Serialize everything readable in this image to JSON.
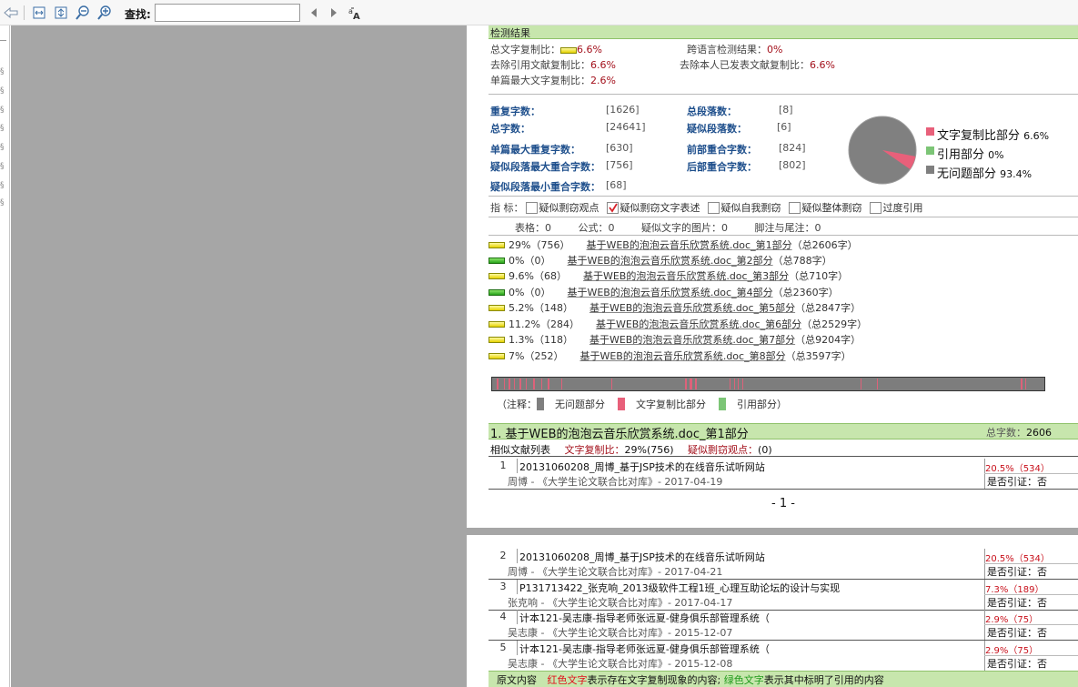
{
  "toolbar": {
    "find_label": "查找:",
    "find_value": ""
  },
  "section_header": "检测结果",
  "summary": {
    "total_copy_label": "总文字复制比：",
    "total_copy_value": "6.6%",
    "cross_lang_label": "跨语言检测结果：",
    "cross_lang_value": "0%",
    "excl_cite_label": "去除引用文献复制比：",
    "excl_cite_value": "6.6%",
    "excl_self_label": "去除本人已发表文献复制比：",
    "excl_self_value": "6.6%",
    "single_max_label": "单篇最大文字复制比：",
    "single_max_value": "2.6%"
  },
  "stats": {
    "dup_chars_label": "重复字数：",
    "dup_chars": "[1626]",
    "total_paras_label": "总段落数：",
    "total_paras": "[8]",
    "total_chars_label": "总字数：",
    "total_chars": "[24641]",
    "susp_paras_label": "疑似段落数：",
    "susp_paras": "[6]",
    "single_max_dup_label": "单篇最大重复字数：",
    "single_max_dup": "[630]",
    "front_overlap_label": "前部重合字数：",
    "front_overlap": "[824]",
    "susp_max_label": "疑似段落最大重合字数：",
    "susp_max": "[756]",
    "back_overlap_label": "后部重合字数：",
    "back_overlap": "[802]",
    "susp_min_label": "疑似段落最小重合字数：",
    "susp_min": "[68]"
  },
  "pie": {
    "legend": [
      {
        "label": "文字复制比部分",
        "value": "6.6%",
        "color": "#e8607a"
      },
      {
        "label": "引用部分",
        "value": "0%",
        "color": "#7cc576"
      },
      {
        "label": "无问题部分",
        "value": "93.4%",
        "color": "#7f7f7f"
      }
    ],
    "copy_fraction": 0.066
  },
  "indicators": {
    "label": "指  标：",
    "items": [
      {
        "label": "疑似剽窃观点",
        "checked": false
      },
      {
        "label": "疑似剽窃文字表述",
        "checked": true
      },
      {
        "label": "疑似自我剽窃",
        "checked": false
      },
      {
        "label": "疑似整体剽窃",
        "checked": false
      },
      {
        "label": "过度引用",
        "checked": false
      }
    ]
  },
  "extras": {
    "tables": "表格：0",
    "formulas": "公式：0",
    "images": "疑似文字的图片：0",
    "footnotes": "脚注与尾注：0"
  },
  "parts": [
    {
      "pct": "29%（756）",
      "name": "基于WEB的泡泡云音乐欣赏系统.doc_第1部分",
      "total": "（总2606字）",
      "color": "y"
    },
    {
      "pct": "0%（0）",
      "name": "基于WEB的泡泡云音乐欣赏系统.doc_第2部分",
      "total": "（总788字）",
      "color": "g"
    },
    {
      "pct": "9.6%（68）",
      "name": "基于WEB的泡泡云音乐欣赏系统.doc_第3部分",
      "total": "（总710字）",
      "color": "y"
    },
    {
      "pct": "0%（0）",
      "name": "基于WEB的泡泡云音乐欣赏系统.doc_第4部分",
      "total": "（总2360字）",
      "color": "g"
    },
    {
      "pct": "5.2%（148）",
      "name": "基于WEB的泡泡云音乐欣赏系统.doc_第5部分",
      "total": "（总2847字）",
      "color": "y"
    },
    {
      "pct": "11.2%（284）",
      "name": "基于WEB的泡泡云音乐欣赏系统.doc_第6部分",
      "total": "（总2529字）",
      "color": "y"
    },
    {
      "pct": "1.3%（118）",
      "name": "基于WEB的泡泡云音乐欣赏系统.doc_第7部分",
      "total": "（总9204字）",
      "color": "y"
    },
    {
      "pct": "7%（252）",
      "name": "基于WEB的泡泡云音乐欣赏系统.doc_第8部分",
      "total": "（总3597字）",
      "color": "y"
    }
  ],
  "bar_legend": {
    "open": "（注释：",
    "none": "无问题部分",
    "copy": "文字复制比部分",
    "cite": "引用部分",
    "close": "）"
  },
  "part1": {
    "title": "1. 基于WEB的泡泡云音乐欣赏系统.doc_第1部分",
    "total_label": "总字数：",
    "total_value": "2606",
    "similar_list": "相似文献列表",
    "copy_label": "文字复制比：",
    "copy_value": "29%(756)",
    "view_label": "疑似剽窃观点：",
    "view_value": "(0)"
  },
  "page_number": "- 1 -",
  "sources": [
    {
      "n": "1",
      "title": "20131060208_周博_基于JSP技术的在线音乐试听网站",
      "meta": "周博 - 《大学生论文联合比对库》- 2017-04-19",
      "pct": "20.5%（534）",
      "cite": "是否引证：否"
    },
    {
      "n": "2",
      "title": "20131060208_周博_基于JSP技术的在线音乐试听网站",
      "meta": "周博 - 《大学生论文联合比对库》- 2017-04-21",
      "pct": "20.5%（534）",
      "cite": "是否引证：否"
    },
    {
      "n": "3",
      "title": "P131713422_张克响_2013级软件工程1班_心理互助论坛的设计与实现",
      "meta": "张克响 - 《大学生论文联合比对库》- 2017-04-17",
      "pct": "7.3%（189）",
      "cite": "是否引证：否"
    },
    {
      "n": "4",
      "title": "计本121-吴志康-指导老师张远夏-健身俱乐部管理系统（",
      "meta": "吴志康 - 《大学生论文联合比对库》- 2015-12-07",
      "pct": "2.9%（75）",
      "cite": "是否引证：否"
    },
    {
      "n": "5",
      "title": "计本121-吴志康-指导老师张远夏-健身俱乐部管理系统（",
      "meta": "吴志康 - 《大学生论文联合比对库》- 2015-12-08",
      "pct": "2.9%（75）",
      "cite": "是否引证：否"
    }
  ],
  "footer": {
    "orig": "原文内容",
    "red": "红色文字",
    "red_desc": "表示存在文字复制现象的内容;",
    "green": "绿色文字",
    "green_desc": "表示其中标明了引用的内容"
  }
}
